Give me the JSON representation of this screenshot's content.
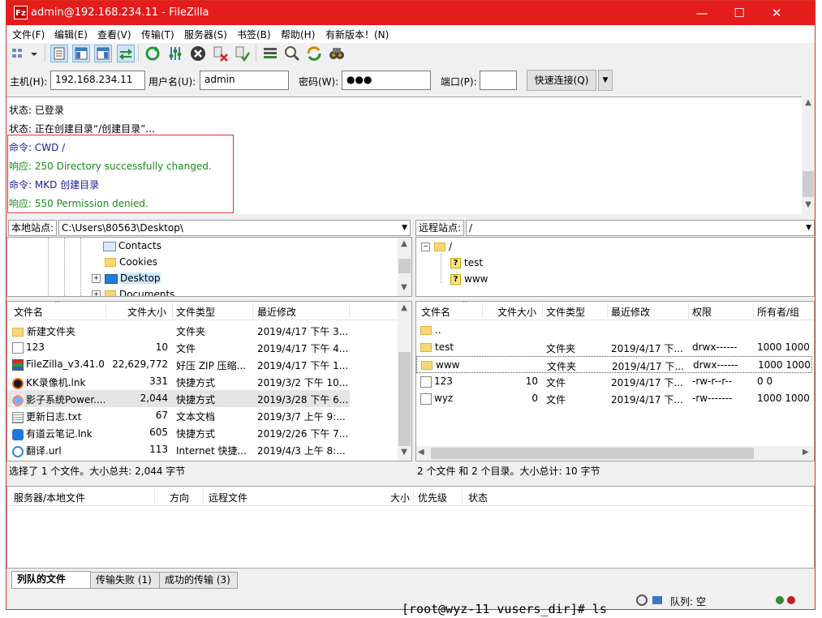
{
  "window": {
    "title": "admin@192.168.234.11 - FileZilla",
    "icon": "Fz",
    "controls": {
      "minimize": "—",
      "maximize": "☐",
      "close": "✕"
    }
  },
  "menu": [
    "文件(F)",
    "编辑(E)",
    "查看(V)",
    "传输(T)",
    "服务器(S)",
    "书签(B)",
    "帮助(H)",
    "有新版本！(N)"
  ],
  "quickconnect": {
    "host_label": "主机(H):",
    "host_value": "192.168.234.11",
    "user_label": "用户名(U):",
    "user_value": "admin",
    "pass_label": "密码(W):",
    "pass_value": "●●●",
    "port_label": "端口(P):",
    "port_value": "",
    "button_label": "快速连接(Q)",
    "dropdown": "▼"
  },
  "log": [
    {
      "text": "状态: 已登录",
      "color": "#000000"
    },
    {
      "text": "状态: 正在创建目录“/创建目录”...",
      "color": "#000000"
    },
    {
      "text": "命令: CWD /",
      "color": "#1a1a9c"
    },
    {
      "text": "响应: 250 Directory successfully changed.",
      "color": "#1a8a1a"
    },
    {
      "text": "命令: MKD 创建目录",
      "color": "#1a1a9c"
    },
    {
      "text": "响应: 550 Permission denied.",
      "color": "#1a8a1a"
    }
  ],
  "local": {
    "site_label": "本地站点:",
    "site_path": "C:\\Users\\80563\\Desktop\\",
    "tree": [
      "Contacts",
      "Cookies",
      "Desktop",
      "Documents"
    ],
    "columns": [
      "文件名",
      "文件大小",
      "文件类型",
      "最近修改"
    ],
    "files": [
      {
        "name": "新建文件夹",
        "size": "",
        "type": "文件夹",
        "modified": "2019/4/17 下午 3...",
        "icon": "folder-icon"
      },
      {
        "name": "123",
        "size": "10",
        "type": "文件",
        "modified": "2019/4/17 下午 4...",
        "icon": "file-icon"
      },
      {
        "name": "FileZilla_v3.41.0....",
        "size": "22,629,772",
        "type": "好压 ZIP 压缩...",
        "modified": "2019/4/17 下午 1...",
        "icon": "zip-icon"
      },
      {
        "name": "KK录像机.lnk",
        "size": "331",
        "type": "快捷方式",
        "modified": "2019/3/2 下午 10...",
        "icon": "recorder-icon"
      },
      {
        "name": "影子系统Power....",
        "size": "2,044",
        "type": "快捷方式",
        "modified": "2019/3/28 下午 6...",
        "icon": "shadow-icon"
      },
      {
        "name": "更新日志.txt",
        "size": "67",
        "type": "文本文档",
        "modified": "2019/3/7 上午 9:...",
        "icon": "text-icon"
      },
      {
        "name": "有道云笔记.lnk",
        "size": "605",
        "type": "快捷方式",
        "modified": "2019/2/26 下午 7...",
        "icon": "note-icon"
      },
      {
        "name": "翻译.url",
        "size": "113",
        "type": "Internet 快捷...",
        "modified": "2019/4/3 上午 8:...",
        "icon": "url-icon"
      }
    ],
    "status": "选择了 1 个文件。大小总共: 2,044 字节"
  },
  "remote": {
    "site_label": "远程站点:",
    "site_path": "/",
    "tree": [
      "/",
      "test",
      "www"
    ],
    "columns": [
      "文件名",
      "文件大小",
      "文件类型",
      "最近修改",
      "权限",
      "所有者/组"
    ],
    "files": [
      {
        "name": "..",
        "size": "",
        "type": "",
        "modified": "",
        "perm": "",
        "owner": "",
        "icon": "folder-icon"
      },
      {
        "name": "test",
        "size": "",
        "type": "文件夹",
        "modified": "2019/4/17 下...",
        "perm": "drwx------",
        "owner": "1000 1000",
        "icon": "folder-icon"
      },
      {
        "name": "www",
        "size": "",
        "type": "文件夹",
        "modified": "2019/4/17 下...",
        "perm": "drwx------",
        "owner": "1000 1000",
        "icon": "folder-icon"
      },
      {
        "name": "123",
        "size": "10",
        "type": "文件",
        "modified": "2019/4/17 下...",
        "perm": "-rw-r--r--",
        "owner": "0 0",
        "icon": "file-icon"
      },
      {
        "name": "wyz",
        "size": "0",
        "type": "文件",
        "modified": "2019/4/17 下...",
        "perm": "-rw-------",
        "owner": "1000 1000",
        "icon": "file-icon"
      }
    ],
    "status": "2 个文件 和 2 个目录。大小总计: 10 字节"
  },
  "queue": {
    "columns": [
      "服务器/本地文件",
      "方向",
      "远程文件",
      "大小",
      "优先级",
      "状态"
    ],
    "tabs": [
      "列队的文件",
      "传输失败 (1)",
      "成功的传输 (3)"
    ],
    "status_label": "队列: 空"
  },
  "behind_text": "[root@wyz-11 vusers_dir]# ls"
}
